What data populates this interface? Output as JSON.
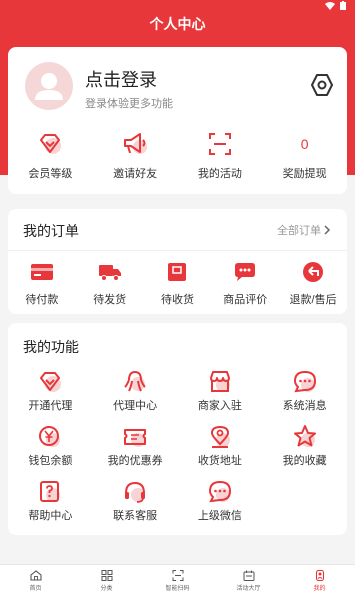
{
  "header": {
    "title": "个人中心"
  },
  "profile": {
    "login_title": "点击登录",
    "login_subtitle": "登录体验更多功能",
    "stats": [
      {
        "icon": "diamond-icon",
        "label": "会员等级"
      },
      {
        "icon": "megaphone-icon",
        "label": "邀请好友"
      },
      {
        "icon": "scan-icon",
        "label": "我的活动"
      },
      {
        "count": "0",
        "label": "奖励提现"
      }
    ]
  },
  "orders": {
    "title": "我的订单",
    "more": "全部订单",
    "items": [
      {
        "icon": "wallet-icon",
        "label": "待付款"
      },
      {
        "icon": "truck-icon",
        "label": "待发货"
      },
      {
        "icon": "receive-box-icon",
        "label": "待收货"
      },
      {
        "icon": "comment-icon",
        "label": "商品评价"
      },
      {
        "icon": "return-icon",
        "label": "退款/售后"
      }
    ]
  },
  "functions": {
    "title": "我的功能",
    "items": [
      {
        "icon": "diamond-icon",
        "label": "开通代理"
      },
      {
        "icon": "octopus-icon",
        "label": "代理中心"
      },
      {
        "icon": "shop-icon",
        "label": "商家入驻"
      },
      {
        "icon": "message-icon",
        "label": "系统消息"
      },
      {
        "icon": "yen-coin-icon",
        "label": "钱包余额"
      },
      {
        "icon": "coupon-icon",
        "label": "我的优惠券"
      },
      {
        "icon": "location-pin-icon",
        "label": "收货地址"
      },
      {
        "icon": "star-icon",
        "label": "我的收藏"
      },
      {
        "icon": "help-icon",
        "label": "帮助中心"
      },
      {
        "icon": "headset-icon",
        "label": "联系客服"
      },
      {
        "icon": "chat-bubble-icon",
        "label": "上级微信"
      }
    ]
  },
  "tabbar": {
    "items": [
      {
        "icon": "home-icon",
        "label": "首页"
      },
      {
        "icon": "category-icon",
        "label": "分类"
      },
      {
        "icon": "scan-code-icon",
        "label": "智能扫码"
      },
      {
        "icon": "event-hall-icon",
        "label": "活动大厅"
      },
      {
        "icon": "profile-icon",
        "label": "我的",
        "active": true
      }
    ]
  },
  "colors": {
    "primary": "#e8373b",
    "icon_fill": "#f7d3d4"
  }
}
